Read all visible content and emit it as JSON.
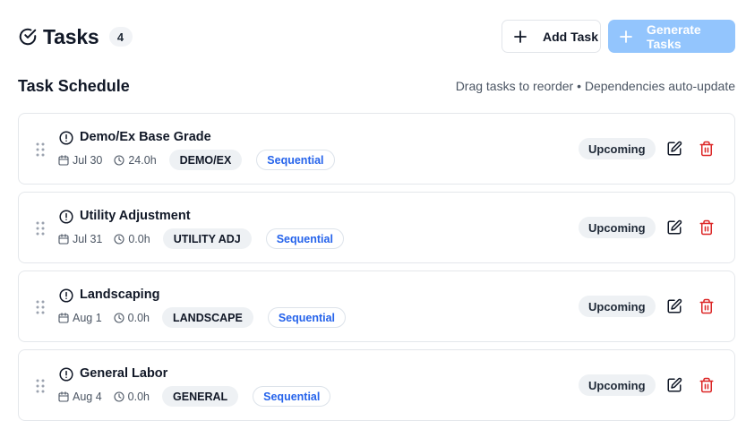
{
  "header": {
    "title": "Tasks",
    "task_count": "4",
    "add_task_label": "Add Task",
    "generate_tasks_label": "Generate Tasks"
  },
  "schedule": {
    "section_title": "Task Schedule",
    "hint": "Drag tasks to reorder • Dependencies auto-update"
  },
  "tasks": [
    {
      "name": "Demo/Ex Base Grade",
      "date": "Jul 30",
      "duration": "24.0h",
      "code": "DEMO/EX",
      "dependency": "Sequential",
      "status": "Upcoming"
    },
    {
      "name": "Utility Adjustment",
      "date": "Jul 31",
      "duration": "0.0h",
      "code": "UTILITY ADJ",
      "dependency": "Sequential",
      "status": "Upcoming"
    },
    {
      "name": "Landscaping",
      "date": "Aug 1",
      "duration": "0.0h",
      "code": "LANDSCAPE",
      "dependency": "Sequential",
      "status": "Upcoming"
    },
    {
      "name": "General Labor",
      "date": "Aug 4",
      "duration": "0.0h",
      "code": "GENERAL",
      "dependency": "Sequential",
      "status": "Upcoming"
    }
  ],
  "icons": {
    "title": "circle-check-icon",
    "add": "plus-icon",
    "generate": "plus-icon",
    "drag": "grip-vertical-icon",
    "task_status": "alert-circle-icon",
    "date": "calendar-icon",
    "duration": "clock-icon",
    "edit": "edit-icon",
    "delete": "trash-icon"
  },
  "colors": {
    "primary_disabled": "#93c5fd",
    "dependency_text": "#2563eb",
    "delete": "#dc2626",
    "badge_bg": "#eef1f4"
  }
}
